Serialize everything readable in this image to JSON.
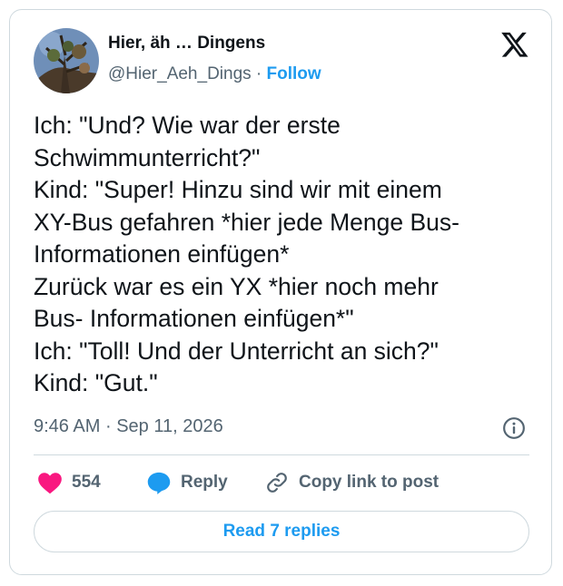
{
  "author": {
    "name": "Hier, äh … Dingens",
    "handle": "@Hier_Aeh_Dings",
    "separator": "·",
    "follow_label": "Follow",
    "avatar_icon": "profile-photo-tree-icon"
  },
  "logo_icon": "x-logo-icon",
  "tweet": {
    "lines": [
      "Ich: \"Und? Wie war der erste",
      "Schwimmunterricht?\"",
      "Kind: \"Super! Hinzu sind wir mit einem",
      "XY-Bus gefahren *hier jede Menge Bus-",
      "Informationen einfügen*",
      "Zurück war es ein YX *hier noch mehr",
      "Bus- Informationen einfügen*\"",
      "Ich: \"Toll! Und der Unterricht an sich?\"",
      "Kind: \"Gut.\""
    ]
  },
  "meta": {
    "time": "9:46 AM",
    "separator": "·",
    "date": "Sep 11, 2026",
    "info_icon": "info-icon"
  },
  "actions": {
    "like_count": "554",
    "reply_label": "Reply",
    "copy_label": "Copy link to post"
  },
  "read_replies_label": "Read 7 replies",
  "colors": {
    "accent": "#1d9bf0",
    "like": "#f91880",
    "text": "#0f1419",
    "secondary": "#536471",
    "border": "#cfd9de"
  }
}
